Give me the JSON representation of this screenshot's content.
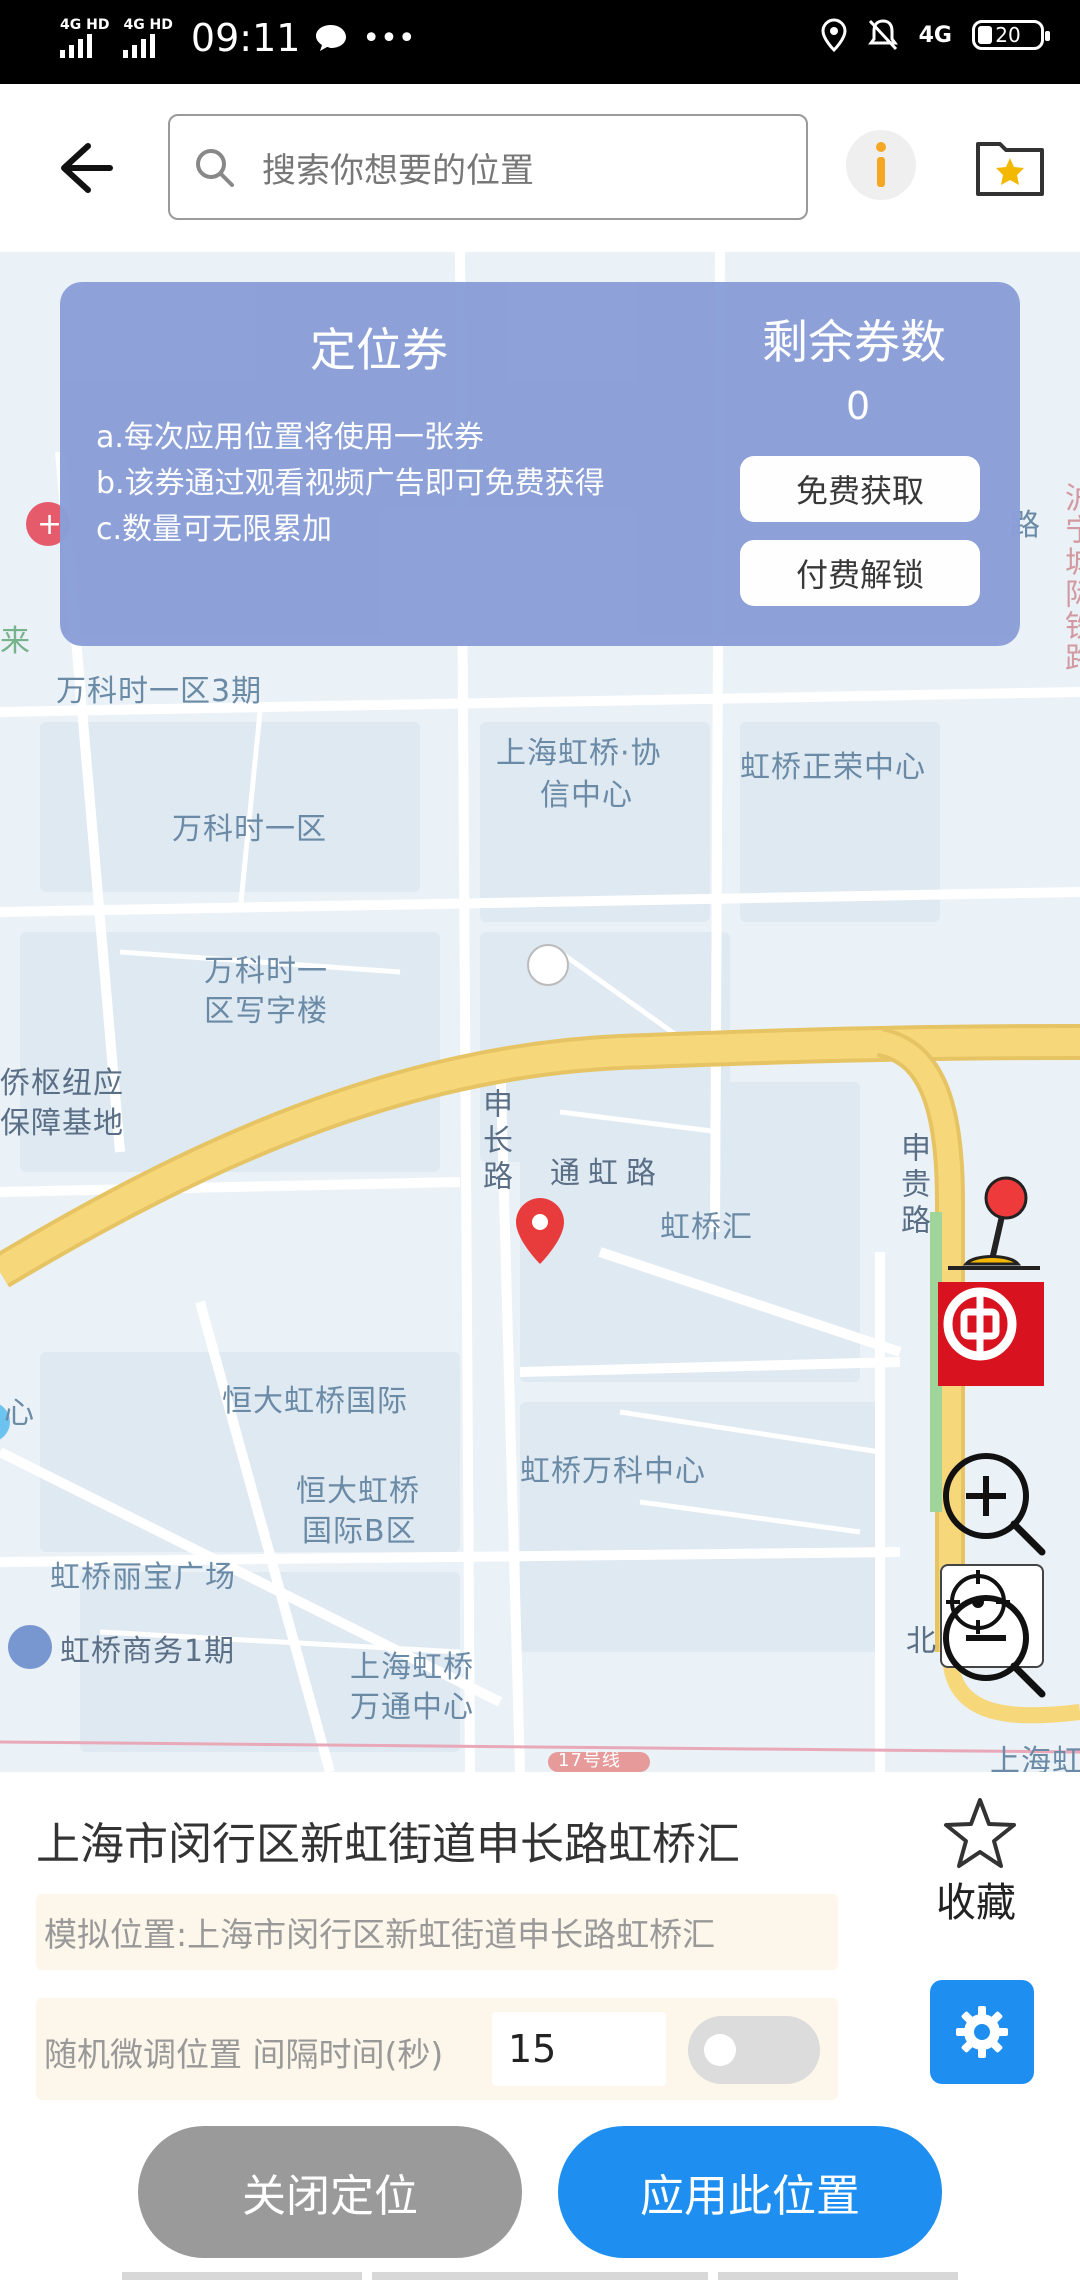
{
  "status_bar": {
    "signal_1": "4G HD",
    "signal_2": "4G HD",
    "time": "09:11",
    "network": "4G",
    "battery": "20"
  },
  "header": {
    "search_placeholder": "搜索你想要的位置"
  },
  "coupon": {
    "title": "定位券",
    "rules": [
      "a.每次应用位置将使用一张券",
      "b.该券通过观看视频广告即可免费获得",
      "c.数量可无限累加"
    ],
    "remaining_title": "剩余券数",
    "remaining_count": "0",
    "free_button": "免费获取",
    "paid_button": "付费解锁"
  },
  "map": {
    "labels": {
      "l1": "万科时一区3期",
      "l2": "上海虹桥·协",
      "l3": "信中心",
      "l4": "虹桥正荣中心",
      "l5": "万科时一区",
      "l6": "万科时一",
      "l7": "区写字楼",
      "l8": "侨枢纽应",
      "l9": "保障基地",
      "l10": "申长路",
      "l11": "通虹路",
      "l12": "申贵路",
      "l13": "虹桥汇",
      "l14": "恒大虹桥国际",
      "l15": "恒大虹桥",
      "l16": "国际B区",
      "l17": "虹桥万科中心",
      "l18": "虹桥丽宝广场",
      "l19": "虹桥商务1期",
      "l20": "上海虹桥",
      "l21": "万通中心",
      "l22": "北13出发",
      "l23": "上海虹",
      "l24": "17号线",
      "l25": "心",
      "l26": "沪宁城际铁路",
      "l27": "来",
      "l28": "路"
    }
  },
  "bottom": {
    "address": "上海市闵行区新虹街道申长路虹桥汇",
    "favorite_label": "收藏",
    "simulated_location": "模拟位置:上海市闵行区新虹街道申长路虹桥汇",
    "random_adjust_label": "随机微调位置 间隔时间(秒)",
    "interval_value": "15",
    "close_button": "关闭定位",
    "apply_button": "应用此位置"
  },
  "colors": {
    "primary": "#1e8ff0",
    "coupon_bg": "#8a9fd8",
    "pin": "#e83b3b",
    "road_major": "#f6d77a",
    "bank_red": "#d9121f"
  }
}
